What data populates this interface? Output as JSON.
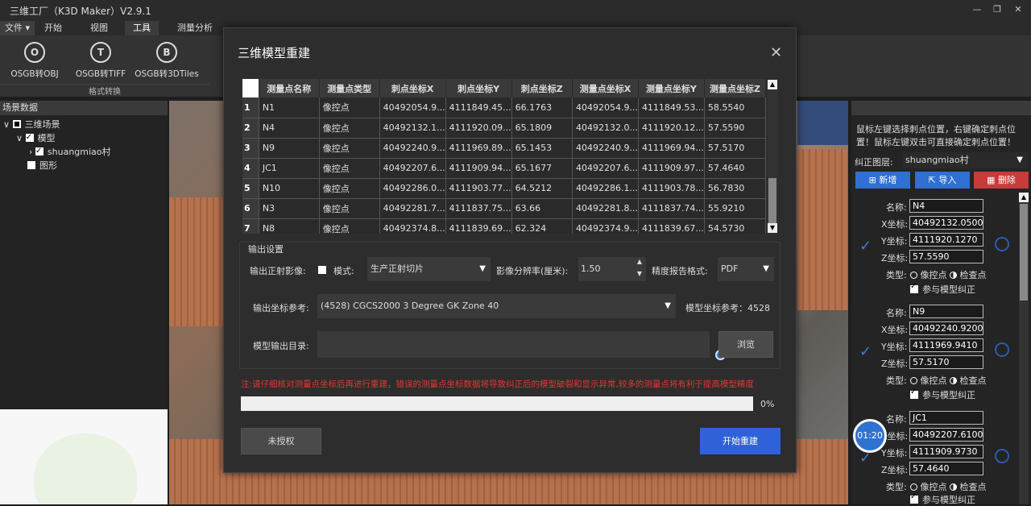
{
  "app": {
    "title": "三维工厂（K3D Maker）V2.9.1"
  },
  "menu": {
    "file": "文件",
    "tabs": [
      "开始",
      "视图",
      "工具",
      "测量分析"
    ]
  },
  "ribbon": {
    "buttons": [
      {
        "icon": "O",
        "label": "OSGB转OBJ"
      },
      {
        "icon": "T",
        "label": "OSGB转TIFF"
      },
      {
        "icon": "B",
        "label": "OSGB转3DTiles"
      }
    ],
    "group": "格式转换"
  },
  "left": {
    "header": "场景数据",
    "tree": [
      "三维场景",
      "模型",
      "shuangmiao村",
      "图形"
    ]
  },
  "right": {
    "tip": "鼠标左键选择刺点位置，右键确定刺点位置！鼠标左键双击可直接确定刺点位置！",
    "layer_label": "纠正图层:",
    "layer_value": "shuangmiao村",
    "add": "新增",
    "import": "导入",
    "delete": "删除",
    "labels": {
      "name": "名称:",
      "x": "X坐标:",
      "y": "Y坐标:",
      "z": "Z坐标:",
      "type": "类型:",
      "control": "像控点",
      "check": "检查点",
      "participate": "参与模型纠正"
    },
    "cards": [
      {
        "name": "N4",
        "x": "40492132.0500",
        "y": "4111920.1270",
        "z": "57.5590"
      },
      {
        "name": "N9",
        "x": "40492240.9200",
        "y": "4111969.9410",
        "z": "57.5170"
      },
      {
        "name": "JC1",
        "x": "40492207.6100",
        "y": "4111909.9730",
        "z": "57.4640"
      }
    ]
  },
  "timer": "01:20",
  "modal": {
    "title": "三维模型重建",
    "columns": [
      "测量点名称",
      "测量点类型",
      "刺点坐标X",
      "刺点坐标Y",
      "刺点坐标Z",
      "测量点坐标X",
      "测量点坐标Y",
      "测量点坐标Z"
    ],
    "rows": [
      [
        "1",
        "N1",
        "像控点",
        "40492054.9...",
        "4111849.45...",
        "66.1763",
        "40492054.9...",
        "4111849.53...",
        "58.5540"
      ],
      [
        "2",
        "N4",
        "像控点",
        "40492132.1...",
        "4111920.09...",
        "65.1809",
        "40492132.0...",
        "4111920.12...",
        "57.5590"
      ],
      [
        "3",
        "N9",
        "像控点",
        "40492240.9...",
        "4111969.89...",
        "65.1453",
        "40492240.9...",
        "4111969.94...",
        "57.5170"
      ],
      [
        "4",
        "JC1",
        "像控点",
        "40492207.6...",
        "4111909.94...",
        "65.1677",
        "40492207.6...",
        "4111909.97...",
        "57.4640"
      ],
      [
        "5",
        "N10",
        "像控点",
        "40492286.0...",
        "4111903.77...",
        "64.5212",
        "40492286.1...",
        "4111903.78...",
        "56.7830"
      ],
      [
        "6",
        "N3",
        "像控点",
        "40492281.7...",
        "4111837.75...",
        "63.66",
        "40492281.8...",
        "4111837.74...",
        "55.9210"
      ],
      [
        "7",
        "N8",
        "像控点",
        "40492374.8...",
        "4111839.69...",
        "62.324",
        "40492374.9...",
        "4111839.67...",
        "54.5730"
      ]
    ],
    "output_section": "输出设置",
    "ortho_label": "输出正射影像:",
    "mode_label": "模式:",
    "mode_value": "生产正射切片",
    "resolution_label": "影像分辨率(厘米):",
    "resolution_value": "1.50",
    "report_label": "精度报告格式:",
    "report_value": "PDF",
    "crs_label": "输出坐标参考:",
    "crs_value": "(4528) CGCS2000 3 Degree GK Zone 40",
    "model_crs": "模型坐标参考：4528",
    "dir_label": "模型输出目录:",
    "dir_value": "",
    "browse": "浏览",
    "warning": "注:请仔细核对测量点坐标后再进行重建，错误的测量点坐标数据将导致纠正后的模型破裂和显示异常,较多的测量点将有利于提高模型精度",
    "progress_percent": 0,
    "progress_text": "0%",
    "unauthorized": "未授权",
    "start": "开始重建"
  }
}
